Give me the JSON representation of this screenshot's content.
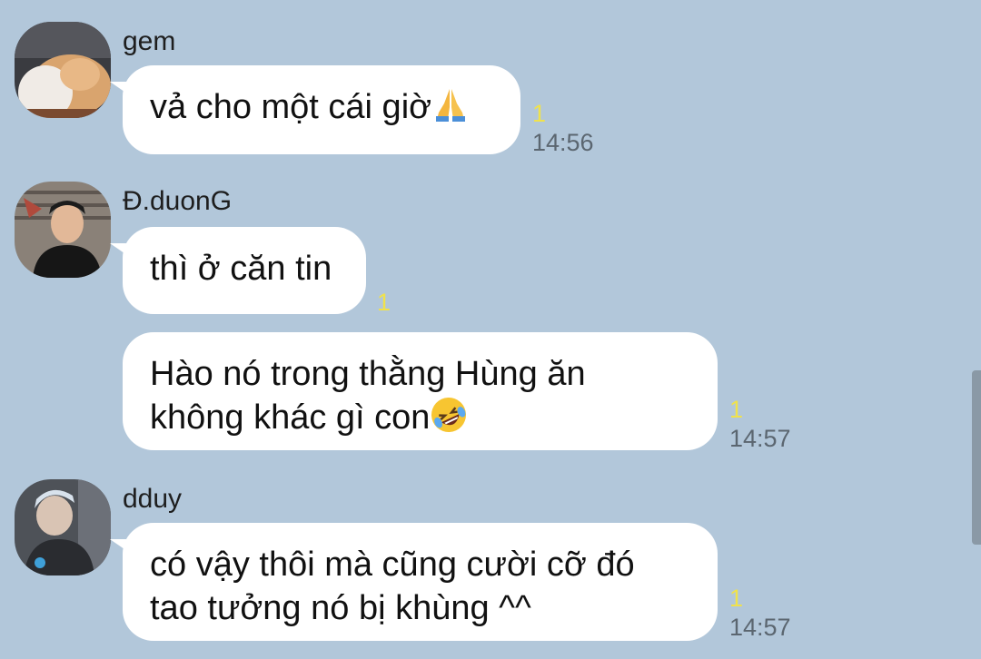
{
  "messages": [
    {
      "sender": "gem",
      "avatar": "avatar-gem",
      "lines": [
        "vả cho một cái giờ"
      ],
      "emoji": "folded-hands-icon",
      "unread": "1",
      "time": "14:56"
    },
    {
      "sender": "Đ.duonG",
      "avatar": "avatar-duong",
      "lines": [
        "thì ở căn tin"
      ],
      "unread": "1",
      "time": ""
    },
    {
      "sender": "",
      "lines": [
        "Hào nó trong thằng Hùng ăn",
        "không khác gì con"
      ],
      "emoji": "rolling-laughing-icon",
      "unread": "1",
      "time": "14:57"
    },
    {
      "sender": "dduy",
      "avatar": "avatar-dduy",
      "lines": [
        "có vậy thôi mà cũng cười cỡ đó",
        "tao tưởng nó bị khùng ^^"
      ],
      "unread": "1",
      "time": "14:57"
    }
  ],
  "colors": {
    "background": "#b2c7da",
    "bubble": "#ffffff",
    "unread": "#f0e24c",
    "time": "#5b6670"
  }
}
